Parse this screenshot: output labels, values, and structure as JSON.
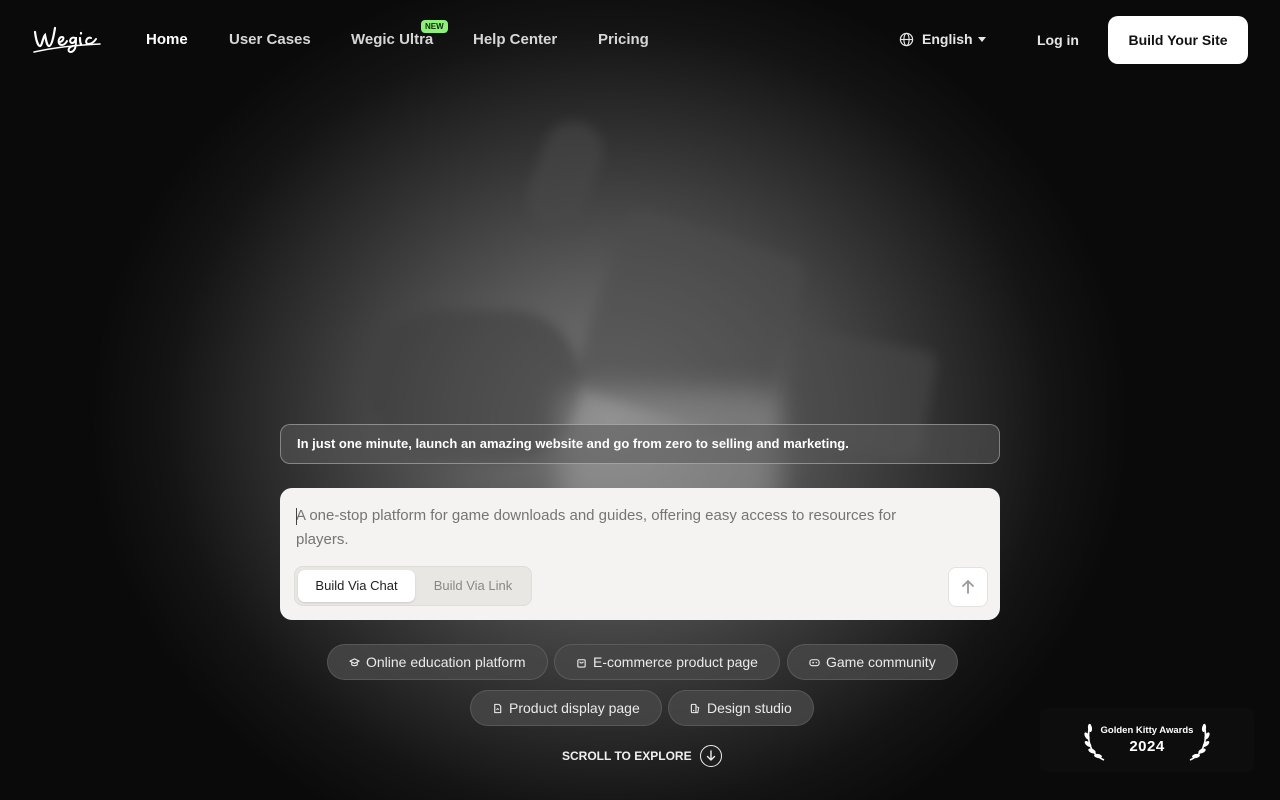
{
  "nav": {
    "logo_text": "wegic",
    "links": [
      {
        "label": "Home"
      },
      {
        "label": "User Cases"
      },
      {
        "label": "Wegic Ultra"
      },
      {
        "label": "Help Center"
      },
      {
        "label": "Pricing"
      }
    ],
    "new_badge": "NEW",
    "language": "English",
    "login": "Log in",
    "cta": "Build Your Site"
  },
  "hero": {
    "tagline": "In just one minute, launch an amazing website and go from zero to selling and marketing.",
    "prompt_placeholder": "A one-stop platform for game downloads and guides, offering easy access to resources for players.",
    "mode_tabs": [
      "Build Via Chat",
      "Build Via Link"
    ],
    "send_icon": "arrow-up-icon"
  },
  "suggestions": [
    {
      "label": "Online education platform",
      "icon": "graduation-cap-icon"
    },
    {
      "label": "E-commerce product page",
      "icon": "shopping-bag-icon"
    },
    {
      "label": "Game community",
      "icon": "gamepad-icon"
    },
    {
      "label": "Product display page",
      "icon": "document-icon"
    },
    {
      "label": "Design studio",
      "icon": "palette-icon"
    }
  ],
  "scroll_label": "SCROLL TO EXPLORE",
  "award": {
    "title": "Golden Kitty Awards",
    "year": "2024"
  },
  "colors": {
    "badge": "#8ef07a",
    "card": "#f4f3f1"
  }
}
